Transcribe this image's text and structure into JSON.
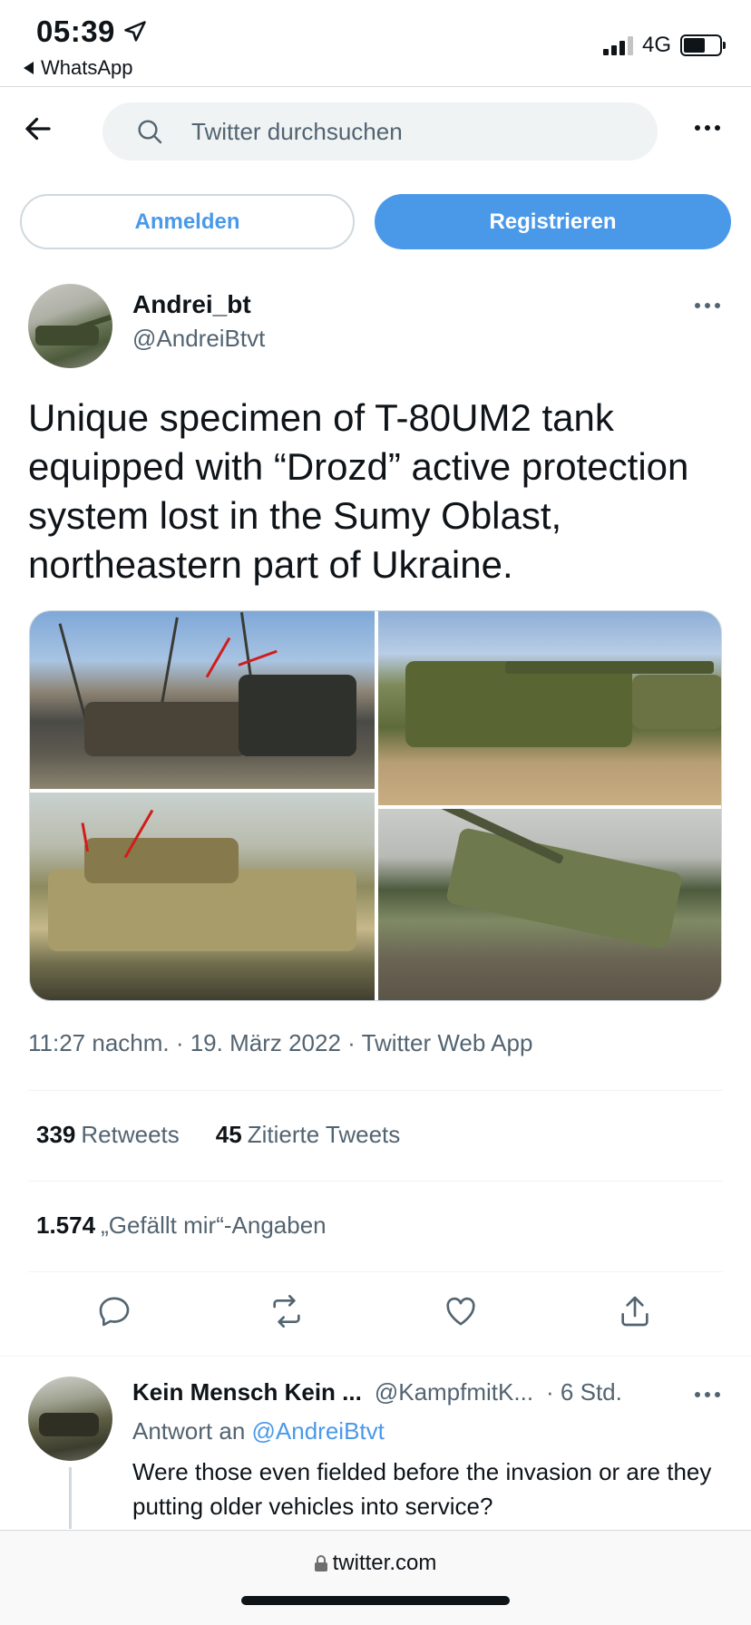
{
  "status_bar": {
    "time": "05:39",
    "back_app": "WhatsApp",
    "network": "4G"
  },
  "header": {
    "search_placeholder": "Twitter durchsuchen"
  },
  "auth": {
    "login_label": "Anmelden",
    "register_label": "Registrieren"
  },
  "tweet": {
    "author_name": "Andrei_bt",
    "author_handle": "@AndreiBtvt",
    "text": "Unique specimen of T-80UM2 tank equipped with “Drozd” active protection system lost in the Sumy Oblast, northeastern part of Ukraine.",
    "meta": "11:27 nachm. · 19. März 2022 · Twitter Web App",
    "retweets_count": "339",
    "retweets_label": "Retweets",
    "quotes_count": "45",
    "quotes_label": "Zitierte Tweets",
    "likes_count": "1.574",
    "likes_label": "„Gefällt mir“-Angaben"
  },
  "reply": {
    "name": "Kein Mensch Kein ...",
    "handle": "@KampfmitK...",
    "time": "· 6 Std.",
    "reply_to_prefix": "Antwort an",
    "reply_to_handle": "@AndreiBtvt",
    "text": "Were those even fielded before the invasion or are they putting older vehicles into service?"
  },
  "browser": {
    "url": "twitter.com"
  },
  "colors": {
    "accent": "#4a99e9",
    "text_primary": "#0f1419",
    "text_secondary": "#536471"
  }
}
